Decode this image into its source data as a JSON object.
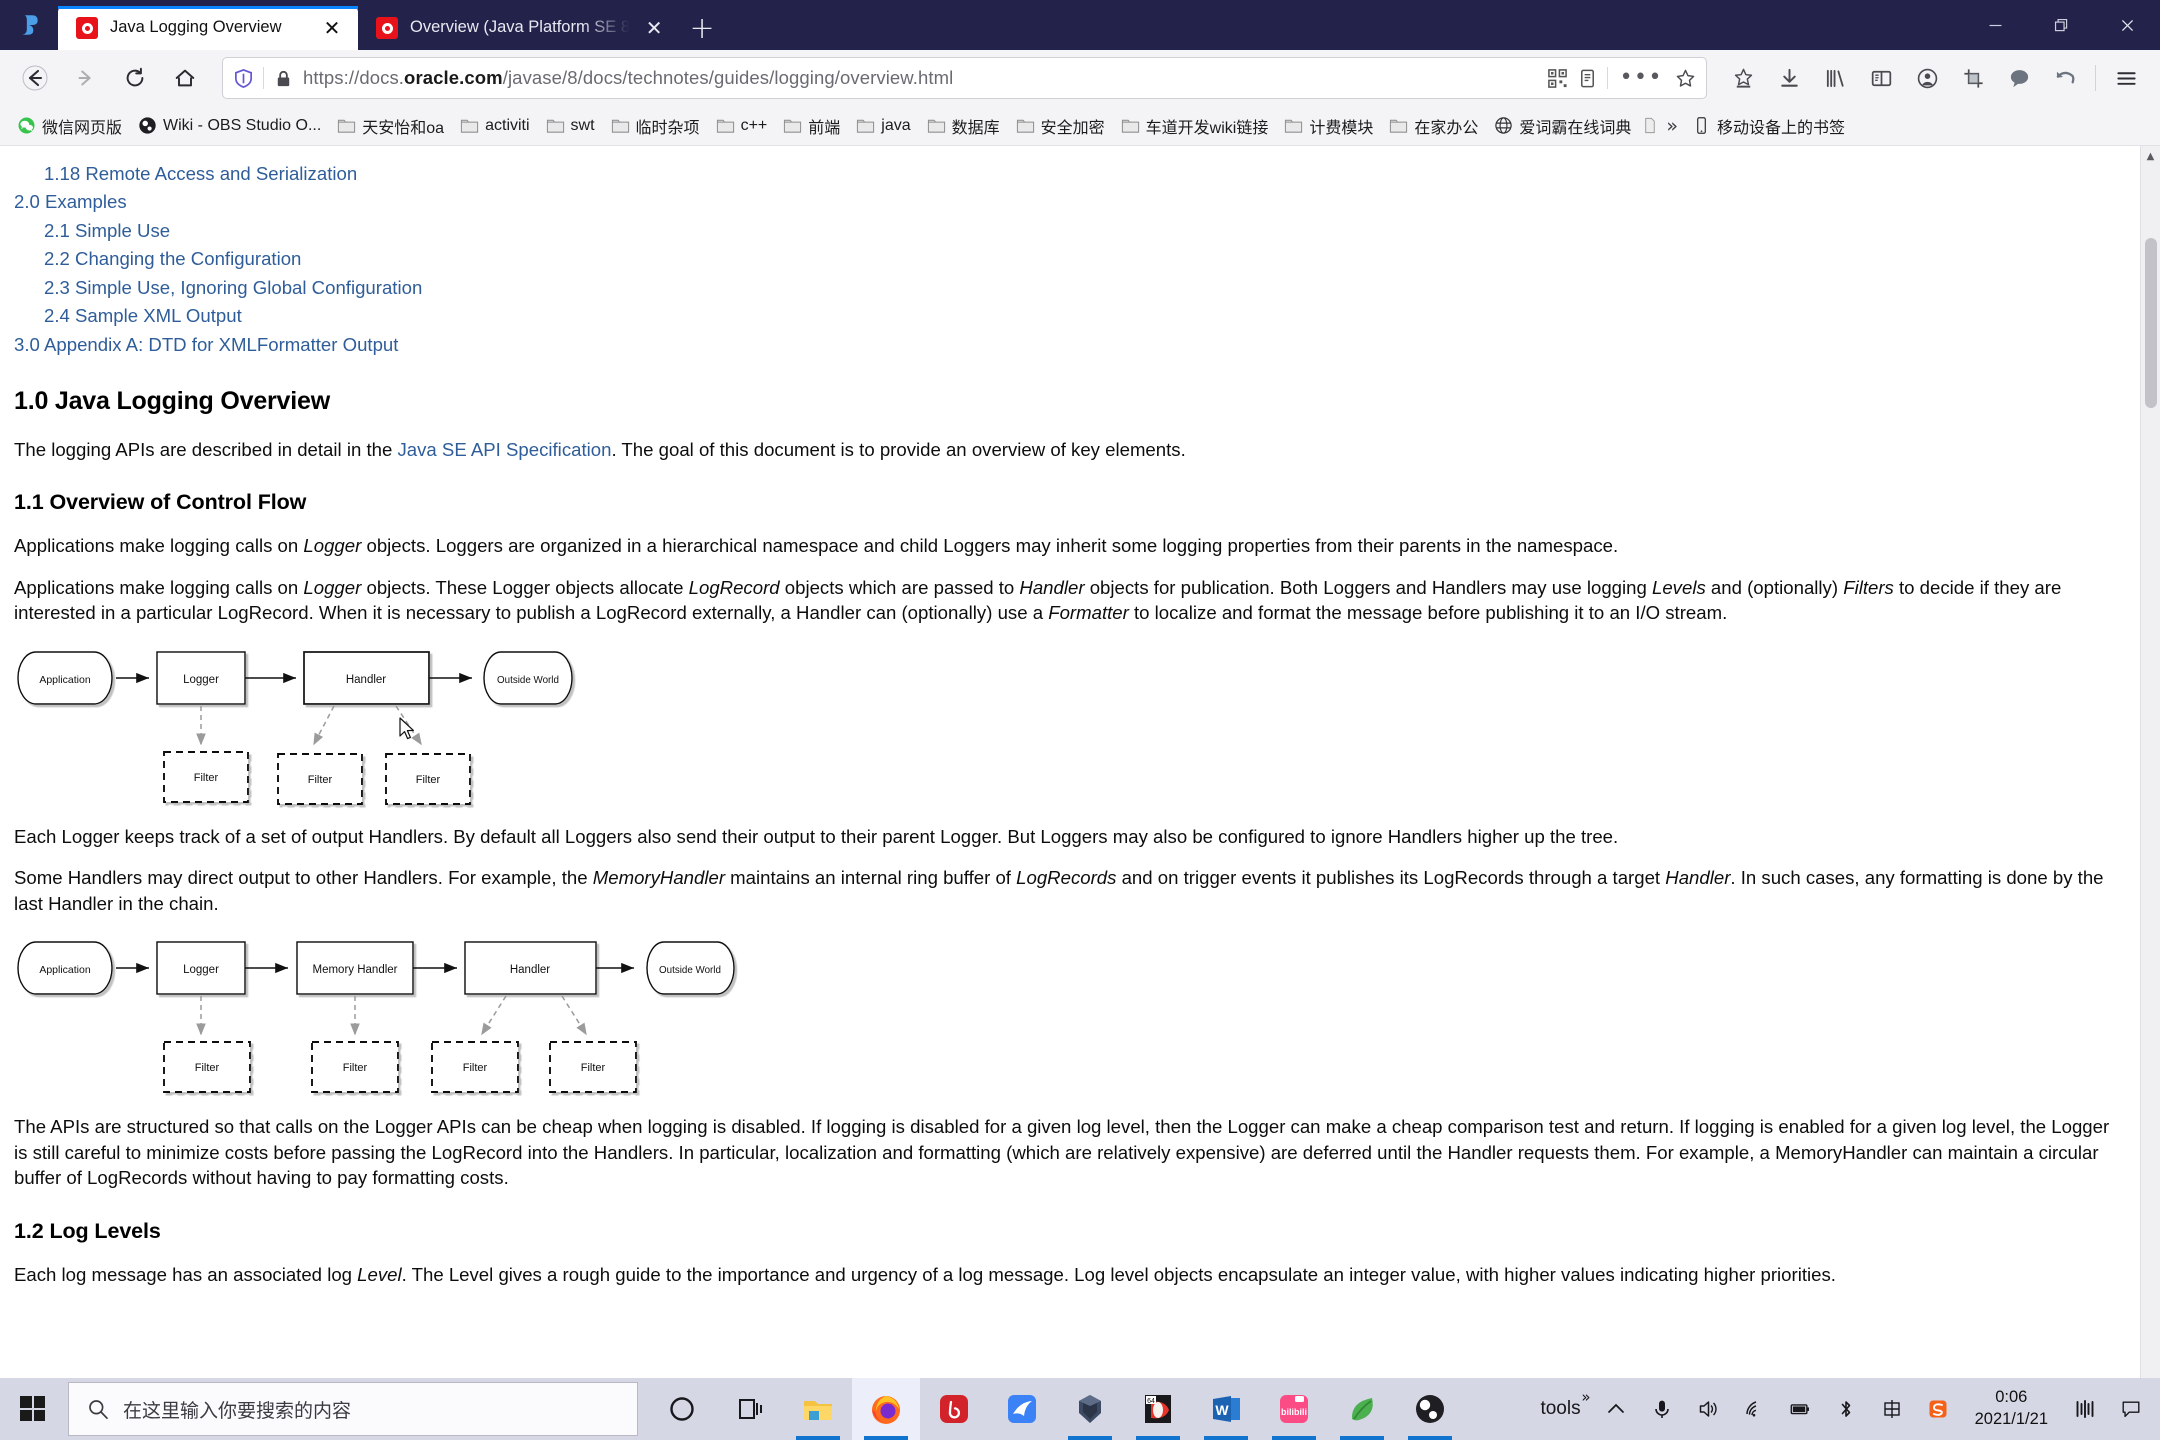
{
  "window": {
    "controls": {
      "minimize": "minimize-icon",
      "restore": "restore-icon",
      "close": "close-icon"
    }
  },
  "tabs": [
    {
      "title": "Java Logging Overview",
      "favicon": "oracle-icon",
      "close": "✕",
      "active": true
    },
    {
      "title": "Overview (Java Platform SE 8",
      "favicon": "oracle-icon",
      "close": "✕",
      "active": false
    }
  ],
  "newtab_label": "+",
  "nav": {
    "back": "back-icon",
    "forward": "forward-icon",
    "reload": "reload-icon",
    "home": "home-icon"
  },
  "address": {
    "url_prefix": "https://docs.",
    "url_host": "oracle.com",
    "url_suffix": "/javase/8/docs/technotes/guides/logging/overview.html",
    "full_url": "https://docs.oracle.com/javase/8/docs/technotes/guides/logging/overview.html",
    "shield_icon": "tracking-protection-icon",
    "lock_icon": "padlock-icon",
    "qr_icon": "qr-code-icon",
    "reader_icon": "reader-mode-icon",
    "more_icon": "•••",
    "star_icon": "bookmark-star-icon"
  },
  "toolbar_buttons": [
    {
      "name": "save-to-pocket-icon"
    },
    {
      "name": "downloads-icon"
    },
    {
      "name": "library-icon"
    },
    {
      "name": "sidebar-icon"
    },
    {
      "name": "account-icon"
    },
    {
      "name": "screenshot-icon"
    },
    {
      "name": "chat-icon"
    },
    {
      "name": "undo-icon"
    },
    {
      "name": "app-menu-icon"
    }
  ],
  "bookmarks": [
    {
      "label": "微信网页版",
      "icon": "wechat-icon"
    },
    {
      "label": "Wiki - OBS Studio O...",
      "icon": "obs-icon"
    },
    {
      "label": "天安怡和oa",
      "icon": "folder-icon"
    },
    {
      "label": "activiti",
      "icon": "folder-icon"
    },
    {
      "label": "swt",
      "icon": "folder-icon"
    },
    {
      "label": "临时杂项",
      "icon": "folder-icon"
    },
    {
      "label": "c++",
      "icon": "folder-icon"
    },
    {
      "label": "前端",
      "icon": "folder-icon"
    },
    {
      "label": "java",
      "icon": "folder-icon"
    },
    {
      "label": "数据库",
      "icon": "folder-icon"
    },
    {
      "label": "安全加密",
      "icon": "folder-icon"
    },
    {
      "label": "车道开发wiki链接",
      "icon": "folder-icon"
    },
    {
      "label": "计费模块",
      "icon": "folder-icon"
    },
    {
      "label": "在家办公",
      "icon": "folder-icon"
    },
    {
      "label": "爱词霸在线词典",
      "icon": "globe-icon"
    }
  ],
  "bookmarks_overflow": "»",
  "bookmarks_mobile": {
    "label": "移动设备上的书签",
    "icon": "mobile-icon"
  },
  "page": {
    "toc": [
      {
        "text": "1.18 Remote Access and Serialization",
        "level": 2
      },
      {
        "text": "2.0 Examples",
        "level": 1
      },
      {
        "text": "2.1 Simple Use",
        "level": 2
      },
      {
        "text": "2.2 Changing the Configuration",
        "level": 2
      },
      {
        "text": "2.3 Simple Use, Ignoring Global Configuration",
        "level": 2
      },
      {
        "text": "2.4 Sample XML Output",
        "level": 2
      },
      {
        "text": "3.0 Appendix A: DTD for XMLFormatter Output",
        "level": 1
      }
    ],
    "h_overview": "1.0 Java Logging Overview",
    "p_intro_a": "The logging APIs are described in detail in the ",
    "p_intro_link": "Java SE API Specification",
    "p_intro_b": ". The goal of this document is to provide an overview of key elements.",
    "h_control_flow": "1.1 Overview of Control Flow",
    "p_flow1_a": "Applications make logging calls on ",
    "p_flow1_i1": "Logger",
    "p_flow1_b": " objects. Loggers are organized in a hierarchical namespace and child Loggers may inherit some logging properties from their parents in the namespace.",
    "p_flow2": "Applications make logging calls on Logger objects. These Logger objects allocate LogRecord objects which are passed to Handler objects for publication. Both Loggers and Handlers may use logging Levels and (optionally) Filters to decide if they are interested in a particular LogRecord. When it is necessary to publish a LogRecord externally, a Handler can (optionally) use a Formatter to localize and format the message before publishing it to an I/O stream.",
    "p_after_d1": "Each Logger keeps track of a set of output Handlers. By default all Loggers also send their output to their parent Logger. But Loggers may also be configured to ignore Handlers higher up the tree.",
    "p_memory": "Some Handlers may direct output to other Handlers. For example, the MemoryHandler maintains an internal ring buffer of LogRecords and on trigger events it publishes its LogRecords through a target Handler. In such cases, any formatting is done by the last Handler in the chain.",
    "p_cheap": "The APIs are structured so that calls on the Logger APIs can be cheap when logging is disabled. If logging is disabled for a given log level, then the Logger can make a cheap comparison test and return. If logging is enabled for a given log level, the Logger is still careful to minimize costs before passing the LogRecord into the Handlers. In particular, localization and formatting (which are relatively expensive) are deferred until the Handler requests them. For example, a MemoryHandler can maintain a circular buffer of LogRecords without having to pay formatting costs.",
    "h_log_levels": "1.2 Log Levels",
    "p_log_levels": "Each log message has an associated log Level. The Level gives a rough guide to the importance and urgency of a log message. Log level objects encapsulate an integer value, with higher values indicating higher priorities."
  },
  "diagram1": {
    "nodes": [
      {
        "id": "application",
        "label": "Application",
        "shape": "cylinder"
      },
      {
        "id": "logger",
        "label": "Logger",
        "shape": "rect"
      },
      {
        "id": "handler",
        "label": "Handler",
        "shape": "rect"
      },
      {
        "id": "outside",
        "label": "Outside World",
        "shape": "cylinder"
      }
    ],
    "filters": [
      {
        "label": "Filter",
        "from": "logger"
      },
      {
        "label": "Filter",
        "from": "handler"
      },
      {
        "label": "Filter",
        "from": "handler"
      }
    ]
  },
  "diagram2": {
    "nodes": [
      {
        "id": "application",
        "label": "Application",
        "shape": "cylinder"
      },
      {
        "id": "logger",
        "label": "Logger",
        "shape": "rect"
      },
      {
        "id": "memory_handler",
        "label": "Memory Handler",
        "shape": "rect"
      },
      {
        "id": "handler",
        "label": "Handler",
        "shape": "rect"
      },
      {
        "id": "outside",
        "label": "Outside World",
        "shape": "cylinder"
      }
    ],
    "filters": [
      {
        "label": "Filter",
        "from": "logger"
      },
      {
        "label": "Filter",
        "from": "memory_handler"
      },
      {
        "label": "Filter",
        "from": "handler"
      },
      {
        "label": "Filter",
        "from": "handler"
      }
    ]
  },
  "taskbar": {
    "start_icon": "windows-start-icon",
    "search_placeholder": "在这里输入你要搜索的内容",
    "search_icon": "search-icon",
    "apps": [
      {
        "name": "cortana-icon",
        "running": false
      },
      {
        "name": "task-view-icon",
        "running": false
      },
      {
        "name": "file-explorer-icon",
        "running": true
      },
      {
        "name": "firefox-icon",
        "running": true,
        "active": true
      },
      {
        "name": "netease-music-icon",
        "running": false
      },
      {
        "name": "foxmail-icon",
        "running": false
      },
      {
        "name": "navicat-icon",
        "running": true
      },
      {
        "name": "winrar-icon",
        "running": true
      },
      {
        "name": "word-icon",
        "running": true
      },
      {
        "name": "bilibili-icon",
        "running": true
      },
      {
        "name": "leaf-app-icon",
        "running": true
      },
      {
        "name": "obs-studio-icon",
        "running": true
      }
    ],
    "tray": {
      "tools_label": "tools",
      "tools_sup": "»",
      "show_hidden_icon": "chevron-up-icon",
      "items": [
        {
          "name": "microphone-icon"
        },
        {
          "name": "volume-icon"
        },
        {
          "name": "wifi-icon"
        },
        {
          "name": "battery-icon"
        },
        {
          "name": "bluetooth-icon"
        },
        {
          "name": "ime-chinese-icon",
          "label": "中"
        },
        {
          "name": "sogou-ime-icon"
        }
      ],
      "clock_time": "0:06",
      "clock_date": "2021/1/21",
      "performance_icon": "performance-monitor-icon",
      "notifications_icon": "action-center-icon"
    }
  },
  "colors": {
    "titlebar": "#23224a",
    "tab_accent": "#0a84ff",
    "link": "#2f5d99",
    "taskbar": "#d6d7e4",
    "oracle_red": "#e8131a"
  }
}
